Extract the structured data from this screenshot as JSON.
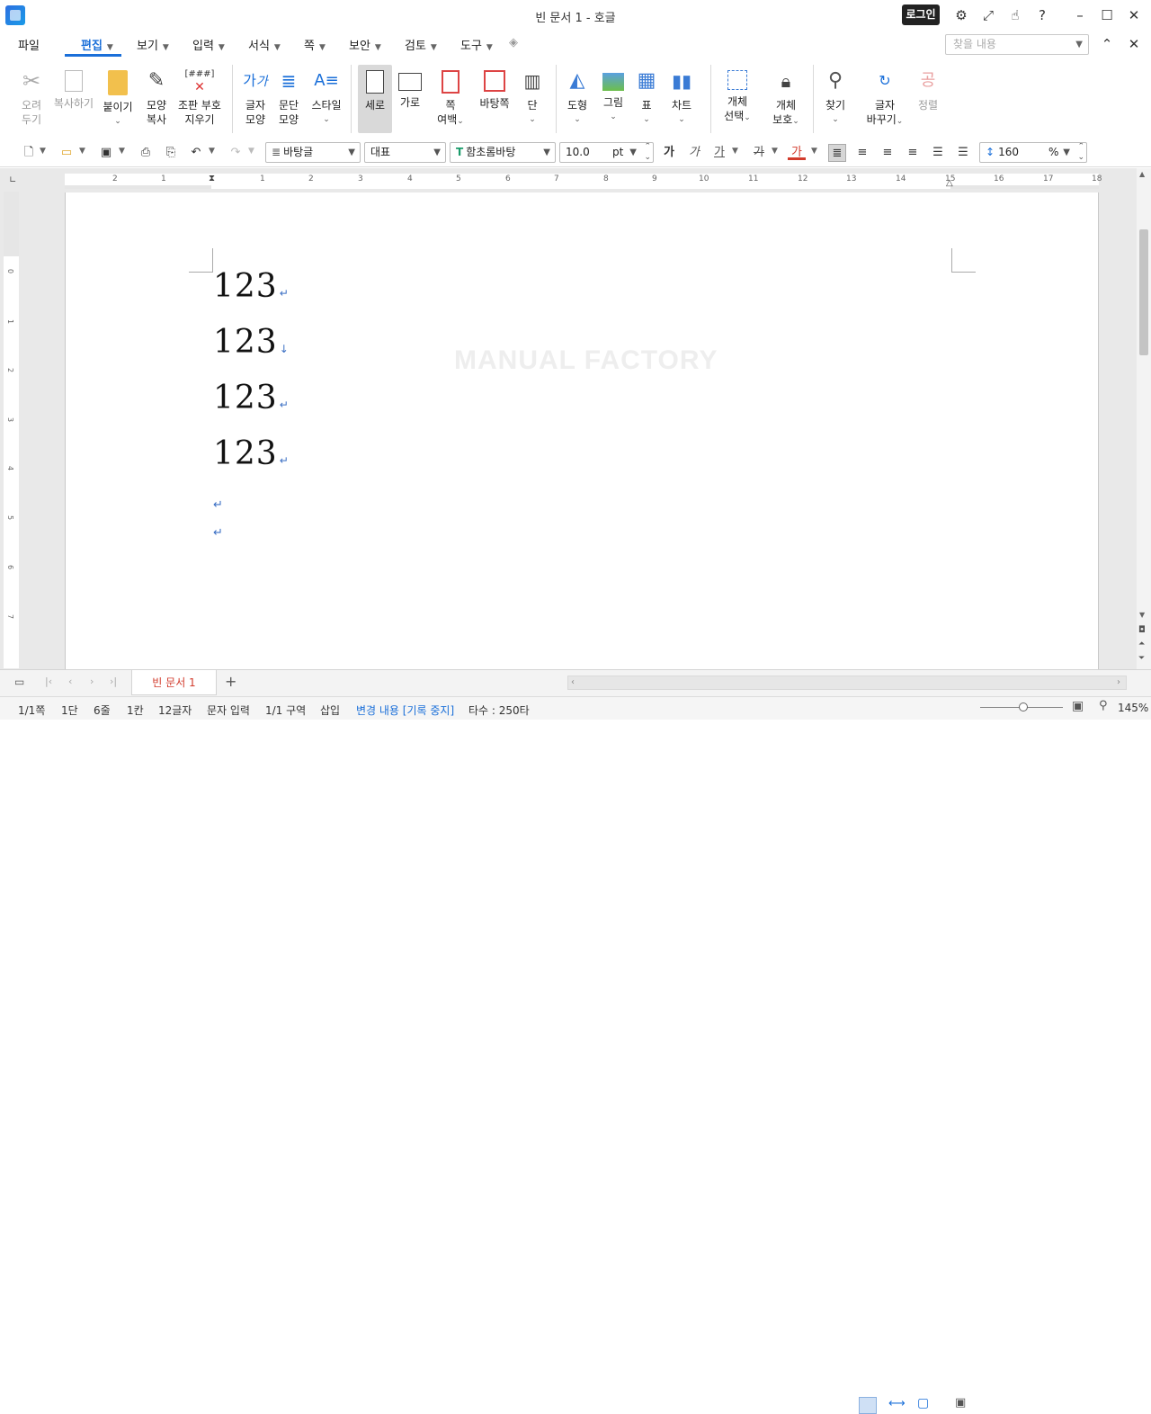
{
  "window": {
    "title": "빈 문서 1 - 호글",
    "login_label": "로그인"
  },
  "menu": {
    "items": [
      {
        "label": "파일"
      },
      {
        "label": "편집"
      },
      {
        "label": "보기"
      },
      {
        "label": "입력"
      },
      {
        "label": "서식"
      },
      {
        "label": "쪽"
      },
      {
        "label": "보안"
      },
      {
        "label": "검토"
      },
      {
        "label": "도구"
      }
    ],
    "active": "편집",
    "search_placeholder": "찾을 내용"
  },
  "ribbon": {
    "cut": [
      "오려",
      "두기"
    ],
    "copy": "복사하기",
    "paste": "붙이기",
    "format_copy": [
      "모양",
      "복사"
    ],
    "clear_marks": [
      "조판 부호",
      "지우기"
    ],
    "clear_marks_icon_text": "[###]",
    "char_shape": [
      "글자",
      "모양"
    ],
    "para_shape": [
      "문단",
      "모양"
    ],
    "style": "스타일",
    "portrait": "세로",
    "landscape": "가로",
    "page_margin": [
      "쪽",
      "여백"
    ],
    "background_page": "바탕쪽",
    "columns": "단",
    "shape": "도형",
    "picture": "그림",
    "table": "표",
    "chart": "차트",
    "object_select": [
      "개체",
      "선택"
    ],
    "object_protect": [
      "개체",
      "보호"
    ],
    "find": "찾기",
    "replace": [
      "글자",
      "바꾸기"
    ],
    "sort": "정렬"
  },
  "format": {
    "style": "바탕글",
    "lang": "대표",
    "font": "함초롬바탕",
    "size": "10.0",
    "size_unit": "pt",
    "line_spacing": "160",
    "line_spacing_unit": "%"
  },
  "ruler": {
    "h_numbers": [
      "2",
      "1",
      "1",
      "2",
      "3",
      "4",
      "5",
      "6",
      "7",
      "8",
      "9",
      "10",
      "11",
      "12",
      "13",
      "14",
      "15",
      "16",
      "17",
      "18"
    ],
    "v_numbers": [
      "1",
      "0",
      "1",
      "2",
      "3",
      "4",
      "5",
      "6",
      "7"
    ]
  },
  "document": {
    "lines": [
      "123",
      "123",
      "123",
      "123"
    ],
    "watermark": "MANUAL FACTORY",
    "paragraph_mark": "↵"
  },
  "tabs": {
    "doc_tab": "빈 문서 1",
    "add": "+"
  },
  "status": {
    "page": "1/1쪽",
    "column": "1단",
    "line": "6줄",
    "col": "1칸",
    "chars": "12글자",
    "mode": "문자 입력",
    "section": "1/1 구역",
    "insert": "삽입",
    "track": "변경 내용 [기록 중지]",
    "keystrokes": "타수 : 250타",
    "zoom": "145%"
  }
}
